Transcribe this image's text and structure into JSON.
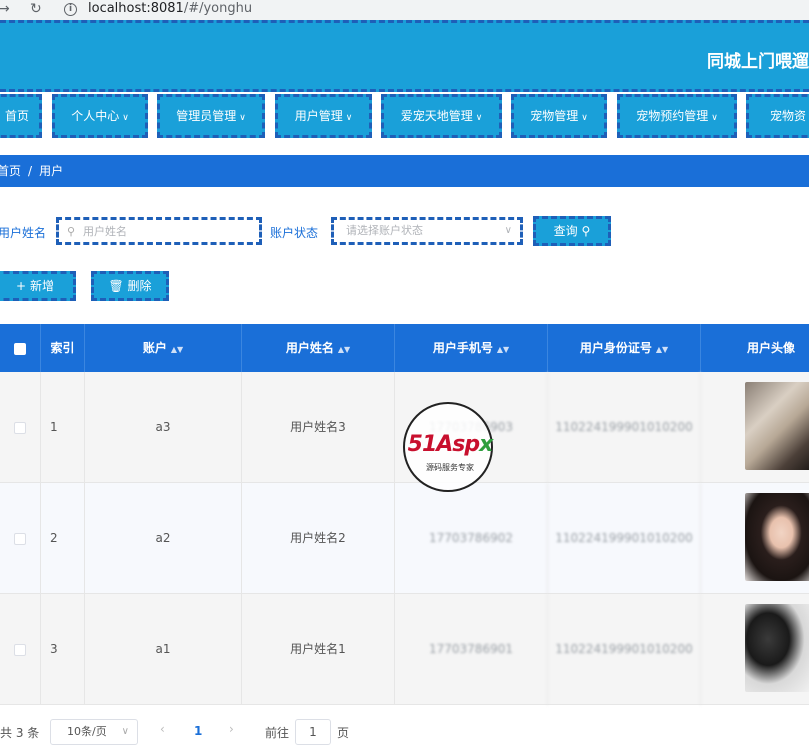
{
  "browser": {
    "url_host": "localhost:8081",
    "url_path": "/#/yonghu"
  },
  "header": {
    "title": "同城上门喂遛"
  },
  "nav": {
    "items": [
      {
        "label": "首页",
        "dropdown": false
      },
      {
        "label": "个人中心",
        "dropdown": true
      },
      {
        "label": "管理员管理",
        "dropdown": true
      },
      {
        "label": "用户管理",
        "dropdown": true
      },
      {
        "label": "爱宠天地管理",
        "dropdown": true
      },
      {
        "label": "宠物管理",
        "dropdown": true
      },
      {
        "label": "宠物预约管理",
        "dropdown": true
      },
      {
        "label": "宠物资",
        "dropdown": false
      }
    ]
  },
  "breadcrumb": {
    "home": "首页",
    "separator": "/",
    "current": "用户"
  },
  "search": {
    "name_label": "用户姓名",
    "name_placeholder": "用户姓名",
    "status_label": "账户状态",
    "status_placeholder": "请选择账户状态",
    "query_button": "查询"
  },
  "actions": {
    "add_button": "新增",
    "delete_button": "删除"
  },
  "table": {
    "columns": [
      "索引",
      "账户",
      "用户姓名",
      "用户手机号",
      "用户身份证号",
      "用户头像"
    ],
    "rows": [
      {
        "index": "1",
        "account": "a3",
        "name": "用户姓名3",
        "phone": "17703786903",
        "id_card": "110224199901010200",
        "avatar": "photo-room"
      },
      {
        "index": "2",
        "account": "a2",
        "name": "用户姓名2",
        "phone": "17703786902",
        "id_card": "110224199901010200",
        "avatar": "photo-woman"
      },
      {
        "index": "3",
        "account": "a1",
        "name": "用户姓名1",
        "phone": "17703786901",
        "id_card": "110224199901010200",
        "avatar": "photo-man"
      }
    ]
  },
  "watermark": {
    "brand_main": "51Asp",
    "brand_accent": "x",
    "tagline": "源码服务专家"
  },
  "pagination": {
    "total": "共 3 条",
    "page_size": "10条/页",
    "current_page": "1",
    "goto_label": "前往",
    "goto_value": "1",
    "page_unit": "页"
  },
  "colors": {
    "header_bg": "#1aa0d9",
    "dashed_border": "#1e5fb8",
    "table_header_bg": "#1a6fd8"
  }
}
